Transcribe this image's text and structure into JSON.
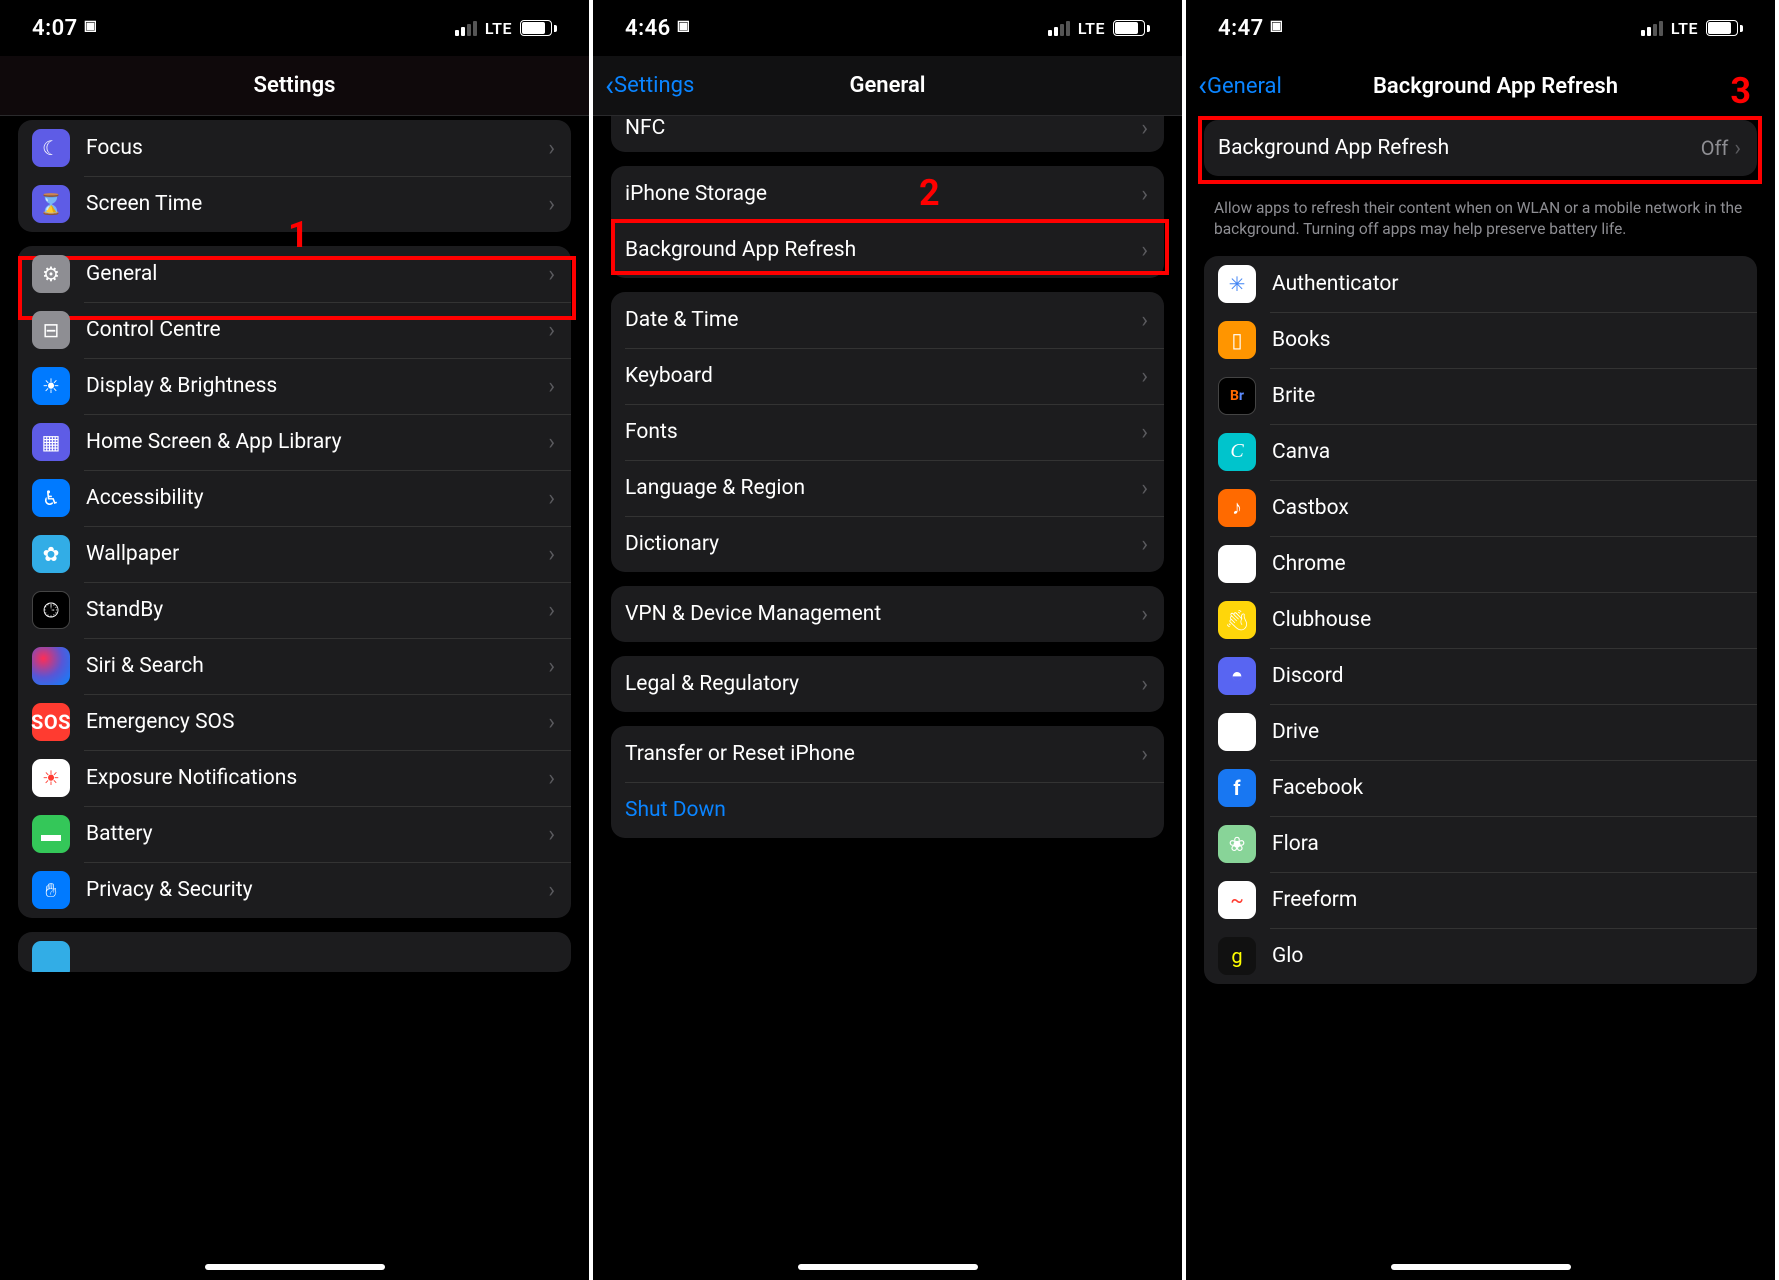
{
  "phone1": {
    "status": {
      "time": "4:07",
      "net": "LTE"
    },
    "title": "Settings",
    "highlight_num": "1",
    "rows": {
      "focus": "Focus",
      "screen_time": "Screen Time",
      "general": "General",
      "control_centre": "Control Centre",
      "display": "Display & Brightness",
      "home_screen": "Home Screen & App Library",
      "accessibility": "Accessibility",
      "wallpaper": "Wallpaper",
      "standby": "StandBy",
      "siri": "Siri & Search",
      "sos": "Emergency SOS",
      "exposure": "Exposure Notifications",
      "battery": "Battery",
      "privacy": "Privacy & Security"
    }
  },
  "phone2": {
    "status": {
      "time": "4:46",
      "net": "LTE"
    },
    "back": "Settings",
    "title": "General",
    "highlight_num": "2",
    "rows": {
      "nfc": "NFC",
      "storage": "iPhone Storage",
      "bar": "Background App Refresh",
      "date": "Date & Time",
      "keyboard": "Keyboard",
      "fonts": "Fonts",
      "lang": "Language & Region",
      "dict": "Dictionary",
      "vpn": "VPN & Device Management",
      "legal": "Legal & Regulatory",
      "transfer": "Transfer or Reset iPhone",
      "shutdown": "Shut Down"
    }
  },
  "phone3": {
    "status": {
      "time": "4:47",
      "net": "LTE"
    },
    "back": "General",
    "title": "Background App Refresh",
    "highlight_num": "3",
    "master": {
      "label": "Background App Refresh",
      "value": "Off"
    },
    "footer": "Allow apps to refresh their content when on WLAN or a mobile network in the background. Turning off apps may help preserve battery life.",
    "apps": {
      "auth": "Authenticator",
      "books": "Books",
      "brite": "Brite",
      "canva": "Canva",
      "castbox": "Castbox",
      "chrome": "Chrome",
      "clubhouse": "Clubhouse",
      "discord": "Discord",
      "drive": "Drive",
      "facebook": "Facebook",
      "flora": "Flora",
      "freeform": "Freeform",
      "glo": "Glo"
    }
  }
}
